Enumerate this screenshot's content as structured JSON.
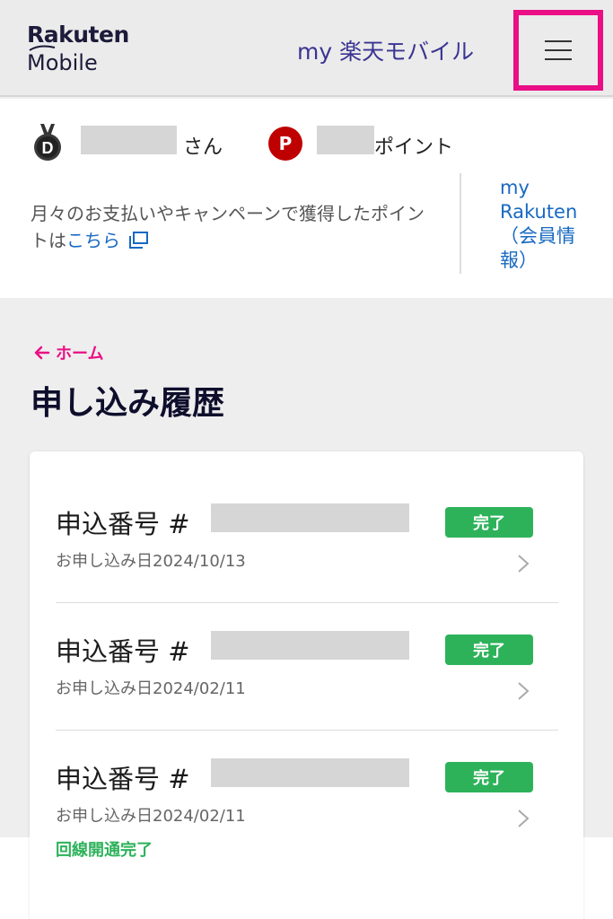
{
  "header": {
    "logo_line1": "Rakuten",
    "logo_line2": "Mobile",
    "brand": "my 楽天モバイル",
    "menu_icon": "hamburger-menu-icon"
  },
  "user": {
    "rank_letter": "D",
    "honorific": "さん",
    "point_icon_letter": "P",
    "points_label": "ポイント",
    "note_text": "月々のお支払いやキャンペーンで獲得したポイントは",
    "note_link": "こちら",
    "my_rakuten_link": "my Rakuten（会員情報）"
  },
  "nav": {
    "back_label": "ホーム"
  },
  "page_title": "申し込み履歴",
  "orders": [
    {
      "label": "申込番号 #",
      "status": "完了",
      "date": "お申し込み日2024/10/13",
      "sub_status": ""
    },
    {
      "label": "申込番号 #",
      "status": "完了",
      "date": "お申し込み日2024/02/11",
      "sub_status": ""
    },
    {
      "label": "申込番号 #",
      "status": "完了",
      "date": "お申し込み日2024/02/11",
      "sub_status": "回線開通完了"
    }
  ],
  "colors": {
    "accent_pink": "#ea0f85",
    "brand_purple": "#3a3493",
    "status_green": "#2db25a",
    "link_blue": "#1769c2",
    "point_red": "#bf0000"
  }
}
